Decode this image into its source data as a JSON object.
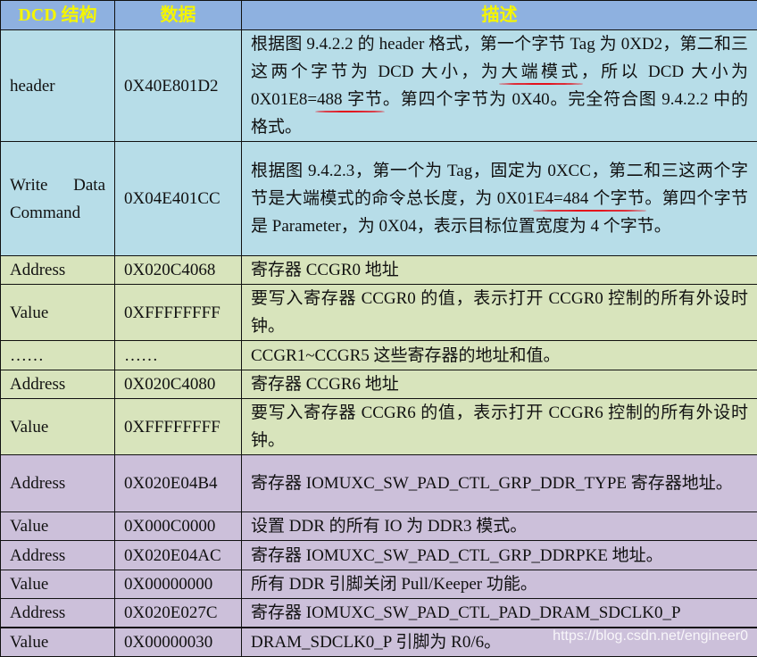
{
  "table": {
    "headers": [
      "DCD 结构",
      "数据",
      "描述"
    ],
    "colors": {
      "header_bg": "#8eb1e0",
      "header_text": "#f5f500",
      "blue_group": "#b7dde8",
      "green_group": "#d8e4bc",
      "purple_group": "#ccc0da",
      "annotation_red": "#e3101b"
    },
    "rows": [
      {
        "group": "blue",
        "struct": "header",
        "data": "0X40E801D2",
        "desc_parts": [
          "根据图 9.4.2.2 的 header 格式，第一个字节 Tag 为 0XD2，第二和三这两个字节为 DCD 大小，为",
          "大端模式",
          "，所以 DCD 大小为 0X01E8=",
          "488 字节",
          "。第四个字节为 0X40。完全符合图 9.4.2.2 中的格式。"
        ]
      },
      {
        "group": "blue",
        "struct": "Write Data Command",
        "data": "0X04E401CC",
        "desc_parts": [
          "根据图 9.4.2.3，第一个为 Tag，固定为 0XCC，第二和三这两个字节是大端模式的命令总长度，为 0X01",
          "E4=484 个字节",
          "。第四个字节是 Parameter，为 0X04，表示目标位置宽度为 4 个字节。"
        ]
      },
      {
        "group": "green",
        "struct": "Address",
        "data": "0X020C4068",
        "desc": "寄存器 CCGR0 地址"
      },
      {
        "group": "green",
        "struct": "Value",
        "data": "0XFFFFFFFF",
        "desc": "要写入寄存器 CCGR0 的值，表示打开 CCGR0 控制的所有外设时钟。"
      },
      {
        "group": "green",
        "struct": "……",
        "data": "……",
        "desc": "CCGR1~CCGR5 这些寄存器的地址和值。"
      },
      {
        "group": "green",
        "struct": "Address",
        "data": "0X020C4080",
        "desc": "寄存器 CCGR6 地址"
      },
      {
        "group": "green",
        "struct": "Value",
        "data": "0XFFFFFFFF",
        "desc": "要写入寄存器 CCGR6 的值，表示打开 CCGR6 控制的所有外设时钟。"
      },
      {
        "group": "purple",
        "struct": "Address",
        "data": "0X020E04B4",
        "desc": "寄存器 IOMUXC_SW_PAD_CTL_GRP_DDR_TYPE 寄存器地址。"
      },
      {
        "group": "purple",
        "struct": "Value",
        "data": "0X000C0000",
        "desc": "设置 DDR 的所有 IO 为 DDR3 模式。"
      },
      {
        "group": "purple",
        "struct": "Address",
        "data": "0X020E04AC",
        "desc": "寄存器 IOMUXC_SW_PAD_CTL_GRP_DDRPKE 地址。"
      },
      {
        "group": "purple",
        "struct": "Value",
        "data": "0X00000000",
        "desc": "所有 DDR 引脚关闭 Pull/Keeper 功能。"
      },
      {
        "group": "purple",
        "struct": "Address",
        "data": "0X020E027C",
        "desc": "寄存器 IOMUXC_SW_PAD_CTL_PAD_DRAM_SDCLK0_P"
      },
      {
        "group": "purple",
        "struct": "Value",
        "data": "0X00000030",
        "desc": "DRAM_SDCLK0_P 引脚为 R0/6。"
      }
    ]
  },
  "watermark": "https://blog.csdn.net/engineer0"
}
